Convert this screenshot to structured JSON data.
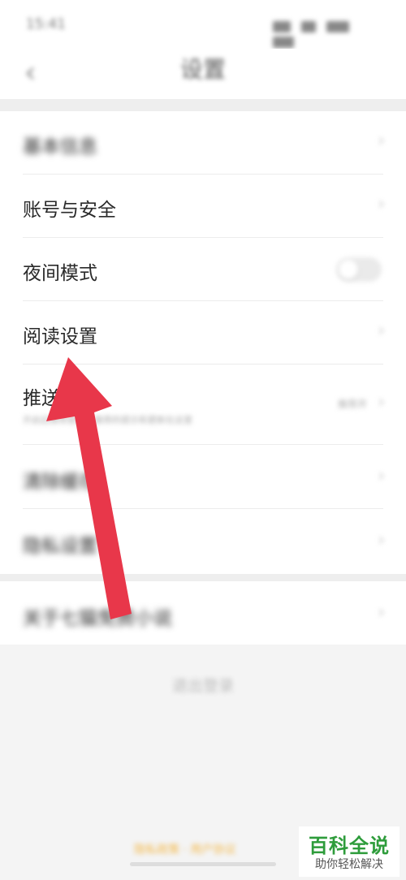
{
  "status_bar": {
    "time": "15:41"
  },
  "header": {
    "title": "设置",
    "back_icon": "chevron-left-icon"
  },
  "settings": {
    "basic_info": "基本信息",
    "account_security": "账号与安全",
    "night_mode": "夜间模式",
    "night_mode_on": false,
    "reading_settings": "阅读设置",
    "push": "推送",
    "push_value": "推荐开",
    "push_description": "开启后推荐更新，推荐的提示和更新在这里",
    "clear_cache": "清除缓存",
    "privacy_settings": "隐私设置",
    "about": "关于七猫免费小说"
  },
  "logout": {
    "label": "退出登录"
  },
  "footer": {
    "links": "隐私政策 · 用户协议"
  },
  "watermark": {
    "title": "百科全说",
    "subtitle": "助你轻松解决"
  },
  "colors": {
    "arrow": "#e8374a",
    "watermark_green": "#2e9c3b"
  }
}
